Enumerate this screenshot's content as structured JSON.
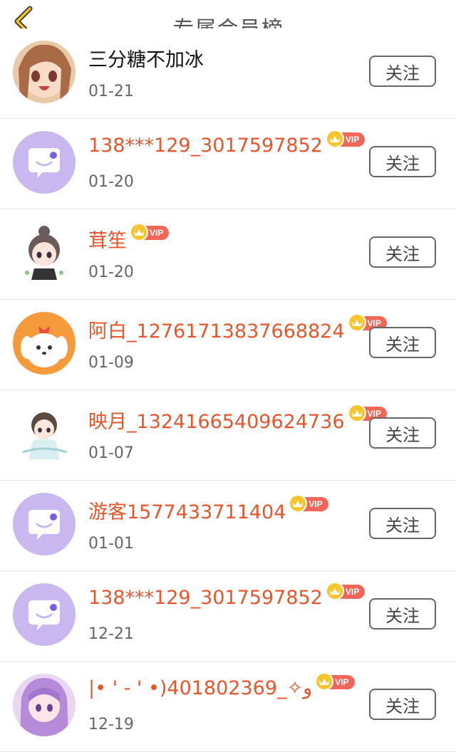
{
  "header": {
    "title": "专属会员榜",
    "back_icon": "chevron-left-icon"
  },
  "colors": {
    "accent": "#e8552b",
    "vip_badge": "#f2665a",
    "crown": "#f7c52c",
    "back_arrow": "#f0c419"
  },
  "follow_label": "关注",
  "vip_label": "VIP",
  "members": [
    {
      "name": "三分糖不加冰",
      "date": "01-21",
      "vip": false,
      "avatar": "anime-girl-brown-hair"
    },
    {
      "name": "138***129_3017597852",
      "date": "01-20",
      "vip": true,
      "avatar": "default-chat-bubble"
    },
    {
      "name": "茸笙",
      "date": "01-20",
      "vip": true,
      "avatar": "chibi-girl-bun"
    },
    {
      "name": "阿白_12761713837668824",
      "date": "01-09",
      "vip": true,
      "avatar": "white-puppy-orange"
    },
    {
      "name": "映月_13241665409624736",
      "date": "01-07",
      "vip": true,
      "avatar": "chibi-girl-hanfu"
    },
    {
      "name": "游客1577433711404",
      "date": "01-01",
      "vip": true,
      "avatar": "default-chat-bubble"
    },
    {
      "name": "138***129_3017597852",
      "date": "12-21",
      "vip": true,
      "avatar": "default-chat-bubble"
    },
    {
      "name": "|• ' - ' •)401802369_✧و",
      "date": "12-19",
      "vip": true,
      "avatar": "anime-girl-purple-hair"
    }
  ]
}
